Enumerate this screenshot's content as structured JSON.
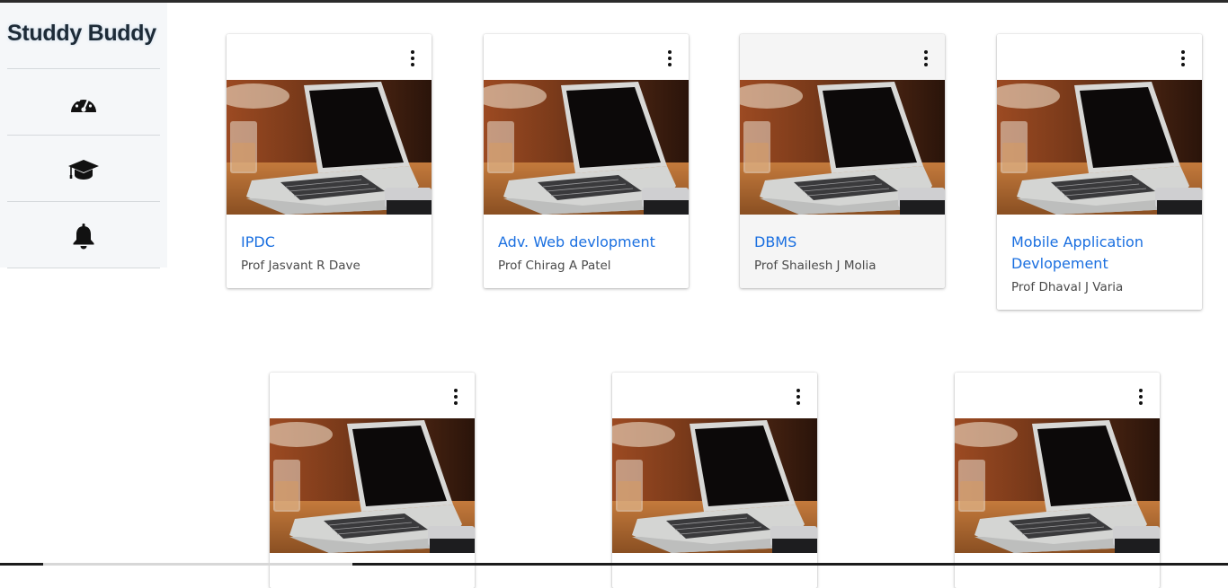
{
  "app": {
    "brand": "Studdy Buddy"
  },
  "sidebar": {
    "items": [
      {
        "icon": "speedometer-icon",
        "name": "dashboard"
      },
      {
        "icon": "graduation-cap-icon",
        "name": "courses"
      },
      {
        "icon": "bell-icon",
        "name": "notifications"
      }
    ]
  },
  "courses": [
    {
      "title": "IPDC",
      "professor": "Prof Jasvant R Dave"
    },
    {
      "title": "Adv. Web devlopment",
      "professor": "Prof Chirag A Patel"
    },
    {
      "title": "DBMS",
      "professor": "Prof Shailesh J Molia"
    },
    {
      "title": "Mobile Application Devlopement",
      "professor": "Prof Dhaval J Varia"
    },
    {
      "title": "",
      "professor": ""
    },
    {
      "title": "",
      "professor": ""
    },
    {
      "title": "",
      "professor": ""
    }
  ],
  "icons": {
    "card_menu": "more-vertical-icon",
    "card_image": "laptop-photo"
  },
  "colors": {
    "link": "#1a6fe0",
    "sidebar_bg": "#f5f7f9",
    "text_muted": "#4a4a4a"
  }
}
